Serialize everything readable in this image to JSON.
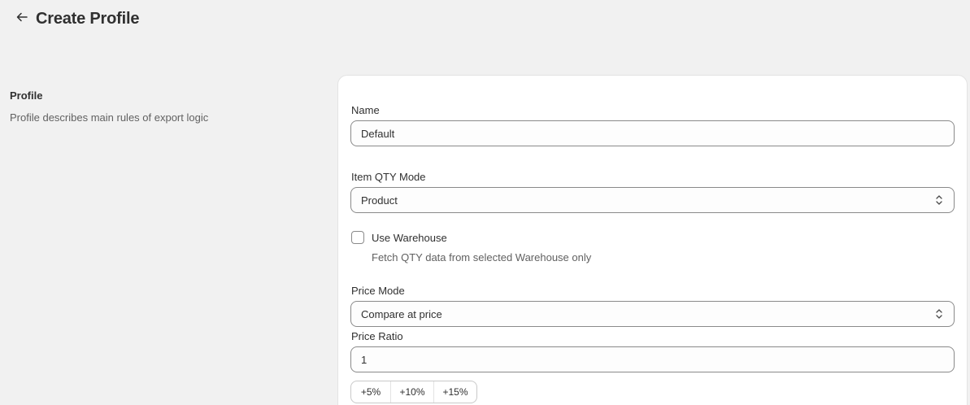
{
  "header": {
    "title": "Create Profile",
    "back_icon": "arrow-left-icon"
  },
  "aside": {
    "title": "Profile",
    "description": "Profile describes main rules of export logic"
  },
  "form": {
    "name_label": "Name",
    "name_value": "Default",
    "qty_mode_label": "Item QTY Mode",
    "qty_mode_value": "Product",
    "use_warehouse_label": "Use Warehouse",
    "use_warehouse_checked": false,
    "use_warehouse_help": "Fetch QTY data from selected Warehouse only",
    "price_mode_label": "Price Mode",
    "price_mode_value": "Compare at price",
    "price_ratio_label": "Price Ratio",
    "price_ratio_value": "1",
    "ratio_buttons": [
      "+5%",
      "+10%",
      "+15%"
    ]
  },
  "colors": {
    "background": "#f1f1f1",
    "card": "#ffffff",
    "border": "#8a8a8a",
    "muted_text": "#616161"
  }
}
